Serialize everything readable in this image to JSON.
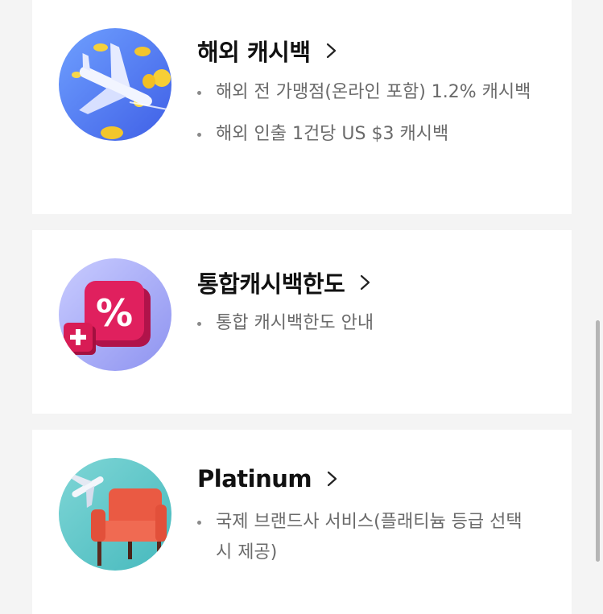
{
  "cards": [
    {
      "title": "해외 캐시백",
      "bullets": [
        "해외 전 가맹점(온라인 포함) 1.2% 캐시백",
        "해외 인출 1건당 US $3 캐시백"
      ],
      "icon": "airplane-coins-icon"
    },
    {
      "title": "통합캐시백한도",
      "bullets": [
        "통합 캐시백한도 안내"
      ],
      "icon": "percent-plus-icon"
    },
    {
      "title": "Platinum",
      "bullets": [
        "국제 브랜드사 서비스(플래티늄 등급 선택 시 제공)"
      ],
      "icon": "armchair-airplane-icon"
    }
  ],
  "colors": {
    "card_bg": "#ffffff",
    "page_bg": "#f4f4f4",
    "title_text": "#111111",
    "bullet_text": "#6a6a6a"
  }
}
